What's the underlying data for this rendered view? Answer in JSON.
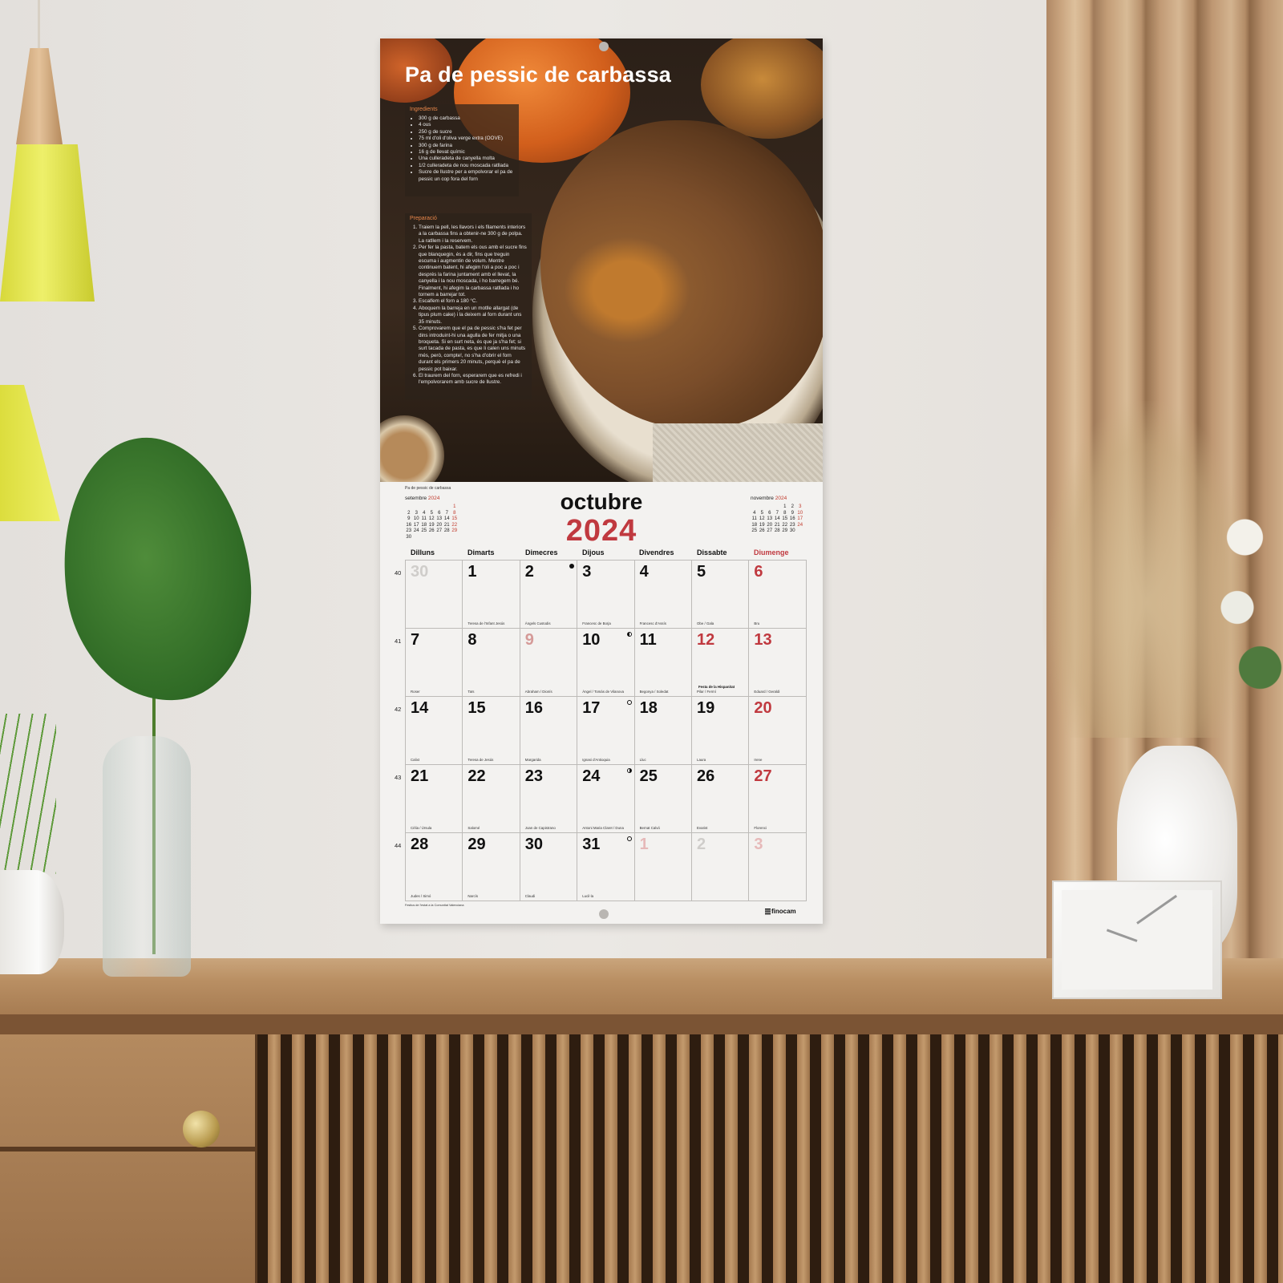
{
  "recipe": {
    "title": "Pa de pessic de carbassa",
    "ingredients_heading": "Ingredients",
    "ingredients": [
      "300 g de carbassa",
      "4 ous",
      "250 g de sucre",
      "75 ml d'oli d'oliva verge extra (OOVE)",
      "300 g de farina",
      "16 g de llevat químic",
      "Una culleradeta de canyella molta",
      "1/2 culleradeta de nou moscada ratllada",
      "Sucre de llustre per a empolvorar el pa de pessic un cop fora del forn"
    ],
    "preparation_heading": "Preparació",
    "steps": [
      "Traiem la pell, les llavors i els filaments interiors a la carbassa fins a obtenir-ne 300 g de polpa. La ratllem i la reservem.",
      "Per fer la pasta, batem els ous amb el sucre fins que blanquegin, és a dir, fins que treguin escuma i augmentin de volum. Mentre continuem batent, hi afegim l'oli a poc a poc i després la farina juntament amb el llevat, la canyella i la nou moscada, i ho barregem bé. Finalment, hi afegim la carbassa ratllada i ho tornem a barrejar tot.",
      "Escalfem el forn a 180 °C.",
      "Aboquem la barreja en un motlle allargat (de tipus plum cake) i la deixem al forn durant uns 35 minuts.",
      "Comprovarem que el pa de pessic s'ha fet per dins introduint-hi una agulla de fer mitja o una broqueta. Si en surt neta, és que ja s'ha fet; si surt tacada de pasta, es que li calen uns minuts més, però, compte!, no s'ha d'obrir el forn durant els primers 20 minuts, perquè el pa de pessic pot baixar.",
      "El traurem del forn, esperarem que es refredi i l'empolvorarem amb sucre de llustre."
    ]
  },
  "calendar": {
    "caption": "Pa de pessic de carbassa",
    "month": "octubre",
    "year": "2024",
    "weekdays": [
      "Dilluns",
      "Dimarts",
      "Dimecres",
      "Dijous",
      "Divendres",
      "Dissabte",
      "Diumenge"
    ],
    "week_numbers": [
      "40",
      "41",
      "42",
      "43",
      "44"
    ],
    "days": [
      {
        "n": "30",
        "saint": "",
        "style": "grey"
      },
      {
        "n": "1",
        "saint": "Teresa de l'Infant Jesús",
        "style": ""
      },
      {
        "n": "2",
        "saint": "Àngels Custodis",
        "style": "",
        "moon": "full"
      },
      {
        "n": "3",
        "saint": "Francesc de Borja",
        "style": ""
      },
      {
        "n": "4",
        "saint": "Francesc d'Assís",
        "style": ""
      },
      {
        "n": "5",
        "saint": "Obe / Gala",
        "style": ""
      },
      {
        "n": "6",
        "saint": "Bru",
        "style": "red"
      },
      {
        "n": "7",
        "saint": "Roser",
        "style": ""
      },
      {
        "n": "8",
        "saint": "Taïs",
        "style": ""
      },
      {
        "n": "9",
        "saint": "Abraham / Dionís",
        "style": "fest"
      },
      {
        "n": "10",
        "saint": "Àngel / Tomàs de Vilanova",
        "style": "",
        "moon": "half"
      },
      {
        "n": "11",
        "saint": "Begonya / Soledat",
        "style": ""
      },
      {
        "n": "12",
        "saint": "Pilar / Fermí",
        "style": "red",
        "holiday": "Festa de la Hispanitat"
      },
      {
        "n": "13",
        "saint": "Eduard / Geraldi",
        "style": "red"
      },
      {
        "n": "14",
        "saint": "Calixt",
        "style": ""
      },
      {
        "n": "15",
        "saint": "Teresa de Jesús",
        "style": ""
      },
      {
        "n": "16",
        "saint": "Margarida",
        "style": ""
      },
      {
        "n": "17",
        "saint": "Ignasi d'Antioquia",
        "style": "",
        "moon": "new"
      },
      {
        "n": "18",
        "saint": "Lluc",
        "style": ""
      },
      {
        "n": "19",
        "saint": "Laura",
        "style": ""
      },
      {
        "n": "20",
        "saint": "Irene",
        "style": "red"
      },
      {
        "n": "21",
        "saint": "Cèlia / Úrsula",
        "style": ""
      },
      {
        "n": "22",
        "saint": "Salomé",
        "style": ""
      },
      {
        "n": "23",
        "saint": "Joan de Capistrano",
        "style": ""
      },
      {
        "n": "24",
        "saint": "Antoni Maria Claret / Duna",
        "style": "",
        "moon": "half2"
      },
      {
        "n": "25",
        "saint": "Bernat Calvó",
        "style": ""
      },
      {
        "n": "26",
        "saint": "Evarist",
        "style": ""
      },
      {
        "n": "27",
        "saint": "Florenci",
        "style": "red"
      },
      {
        "n": "28",
        "saint": "Judes / Simó",
        "style": ""
      },
      {
        "n": "29",
        "saint": "Narcís",
        "style": ""
      },
      {
        "n": "30",
        "saint": "Claudi",
        "style": ""
      },
      {
        "n": "31",
        "saint": "Lucil·la",
        "style": "",
        "moon": "new"
      },
      {
        "n": "1",
        "saint": "",
        "style": "pink"
      },
      {
        "n": "2",
        "saint": "",
        "style": "grey"
      },
      {
        "n": "3",
        "saint": "",
        "style": "pink"
      }
    ],
    "prev_month": {
      "name": "setembre",
      "year": "2024",
      "rows": [
        [
          "",
          "",
          "",
          "",
          "",
          "",
          "1"
        ],
        [
          "2",
          "3",
          "4",
          "5",
          "6",
          "7",
          "8"
        ],
        [
          "9",
          "10",
          "11",
          "12",
          "13",
          "14",
          "15"
        ],
        [
          "16",
          "17",
          "18",
          "19",
          "20",
          "21",
          "22"
        ],
        [
          "23",
          "24",
          "25",
          "26",
          "27",
          "28",
          "29"
        ],
        [
          "30",
          "",
          "",
          "",
          "",
          "",
          ""
        ]
      ]
    },
    "next_month": {
      "name": "novembre",
      "year": "2024",
      "rows": [
        [
          "",
          "",
          "",
          "",
          "1",
          "2",
          "3"
        ],
        [
          "4",
          "5",
          "6",
          "7",
          "8",
          "9",
          "10"
        ],
        [
          "11",
          "12",
          "13",
          "14",
          "15",
          "16",
          "17"
        ],
        [
          "18",
          "19",
          "20",
          "21",
          "22",
          "23",
          "24"
        ],
        [
          "25",
          "26",
          "27",
          "28",
          "29",
          "30",
          ""
        ]
      ]
    },
    "footnote": "Festius de l'estat a la Comunitat Valenciana",
    "brand": "finocam"
  },
  "colors": {
    "accent_red": "#c0393f",
    "ingredient_heading": "#e8864a"
  }
}
